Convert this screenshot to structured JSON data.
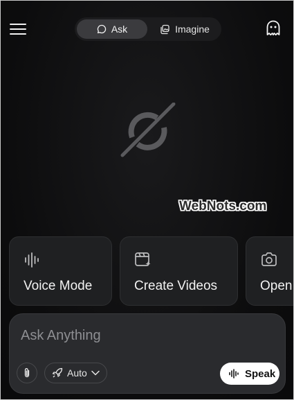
{
  "header": {
    "menu_icon": "hamburger-menu-icon",
    "tabs": [
      {
        "label": "Ask",
        "icon": "chat-bubble-icon",
        "active": true
      },
      {
        "label": "Imagine",
        "icon": "image-stack-icon",
        "active": false
      }
    ],
    "profile_icon": "ghost-icon"
  },
  "logo": {
    "icon": "grok-logo"
  },
  "watermark": {
    "text": "WebNots.com"
  },
  "cards": [
    {
      "label": "Voice Mode",
      "icon": "waveform-icon"
    },
    {
      "label": "Create Videos",
      "icon": "video-sparkle-icon"
    },
    {
      "label": "Open",
      "icon": "camera-icon"
    }
  ],
  "composer": {
    "placeholder": "Ask Anything",
    "attach_icon": "paperclip-icon",
    "mode_label": "Auto",
    "mode_icon": "rocket-icon",
    "speak_label": "Speak",
    "speak_icon": "waveform-icon"
  },
  "colors": {
    "background": "#0c0c0d",
    "card": "#1f2022",
    "input": "#2a2b2e",
    "speak_button": "#ffffff"
  }
}
